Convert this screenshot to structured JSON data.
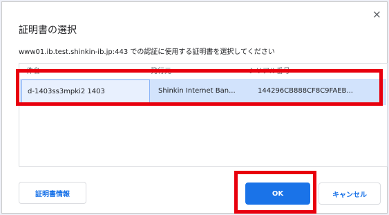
{
  "dialog": {
    "close_icon": "×",
    "title": "証明書の選択",
    "subtitle": "www01.ib.test.shinkin-ib.jp:443 での認証に使用する証明書を選択してください"
  },
  "table": {
    "headers": [
      "件名",
      "発行元",
      "シリアル番号"
    ],
    "rows": [
      {
        "subject": "d-1403ss3mpki2 1403",
        "issuer": "Shinkin Internet Ban...",
        "serial": "144296CB888CF8C9FAEB..."
      }
    ]
  },
  "buttons": {
    "info": "証明書情報",
    "ok": "OK",
    "cancel": "キャンセル"
  },
  "colors": {
    "accent": "#1a73e8",
    "selected_row": "#d2e3fc",
    "highlight_box": "#e8000d"
  }
}
